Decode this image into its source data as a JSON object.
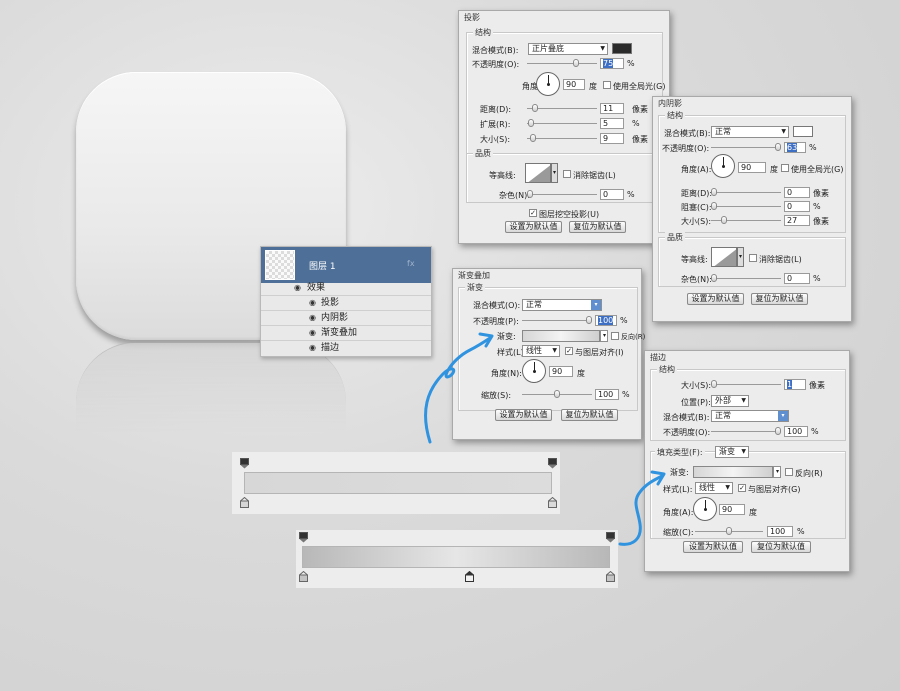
{
  "shadow": {
    "title": "投影",
    "structure": "结构",
    "blend_mode_label": "混合模式(B):",
    "blend_mode": "正片叠底",
    "shadow_color": "#2a2a2a",
    "opacity_label": "不透明度(O):",
    "opacity": "75",
    "angle_label": "角度(A):",
    "angle": "90",
    "degree": "度",
    "global_light": "使用全局光(G)",
    "distance_label": "距离(D):",
    "distance": "11",
    "spread_label": "扩展(R):",
    "spread": "5",
    "size_label": "大小(S):",
    "size": "9",
    "unit_px": "像素",
    "unit_pct": "%",
    "quality": "品质",
    "contour_label": "等高线:",
    "antialias": "消除锯齿(L)",
    "noise_label": "杂色(N):",
    "noise": "0",
    "knockout": "图层挖空投影(U)",
    "default_btn": "设置为默认值",
    "reset_btn": "复位为默认值"
  },
  "inner_shadow": {
    "title": "内阴影",
    "structure": "结构",
    "blend_mode_label": "混合模式(B):",
    "blend_mode": "正常",
    "shadow_color": "#ffffff",
    "opacity_label": "不透明度(O):",
    "opacity": "63",
    "angle_label": "角度(A):",
    "angle": "90",
    "degree": "度",
    "global_light": "使用全局光(G)",
    "distance_label": "距离(D):",
    "distance": "0",
    "choke_label": "阻塞(C):",
    "choke": "0",
    "size_label": "大小(S):",
    "size": "27",
    "unit_px": "像素",
    "unit_pct": "%",
    "quality": "品质",
    "contour_label": "等高线:",
    "antialias": "消除锯齿(L)",
    "noise_label": "杂色(N):",
    "noise": "0",
    "default_btn": "设置为默认值",
    "reset_btn": "复位为默认值"
  },
  "gradient_overlay": {
    "title": "渐变叠加",
    "section": "渐变",
    "blend_mode_label": "混合模式(O):",
    "blend_mode": "正常",
    "opacity_label": "不透明度(P):",
    "opacity": "100",
    "gradient_label": "渐变:",
    "reverse": "反向(R)",
    "style_label": "样式(L):",
    "style": "线性",
    "align": "与图层对齐(I)",
    "angle_label": "角度(N):",
    "angle": "90",
    "degree": "度",
    "scale_label": "缩放(S):",
    "scale": "100",
    "unit_pct": "%",
    "default_btn": "设置为默认值",
    "reset_btn": "复位为默认值"
  },
  "stroke": {
    "title": "描边",
    "structure": "结构",
    "size_label": "大小(S):",
    "size": "1",
    "unit_px": "像素",
    "position_label": "位置(P):",
    "position": "外部",
    "blend_mode_label": "混合模式(B):",
    "blend_mode": "正常",
    "opacity_label": "不透明度(O):",
    "opacity": "100",
    "unit_pct": "%",
    "fill_type_label": "填充类型(F):",
    "fill_type": "渐变",
    "gradient_label": "渐变:",
    "reverse": "反向(R)",
    "style_label": "样式(L):",
    "style": "线性",
    "align": "与图层对齐(G)",
    "angle_label": "角度(A):",
    "angle": "90",
    "degree": "度",
    "scale_label": "缩放(C):",
    "scale": "100",
    "default_btn": "设置为默认值",
    "reset_btn": "复位为默认值"
  },
  "layers": {
    "layer_name": "图层 1",
    "fx_badge": "fx",
    "effects_label": "效果",
    "effects": [
      "投影",
      "内阴影",
      "渐变叠加",
      "描边"
    ]
  },
  "colors": {
    "arrow_blue": "#2f93e0",
    "layer_selected": "#4e6f97"
  },
  "icons": [
    "eye-icon",
    "dropdown-arrow-icon",
    "contour-icon",
    "angle-dial-icon",
    "color-stop-icon",
    "curved-arrow-icon"
  ]
}
